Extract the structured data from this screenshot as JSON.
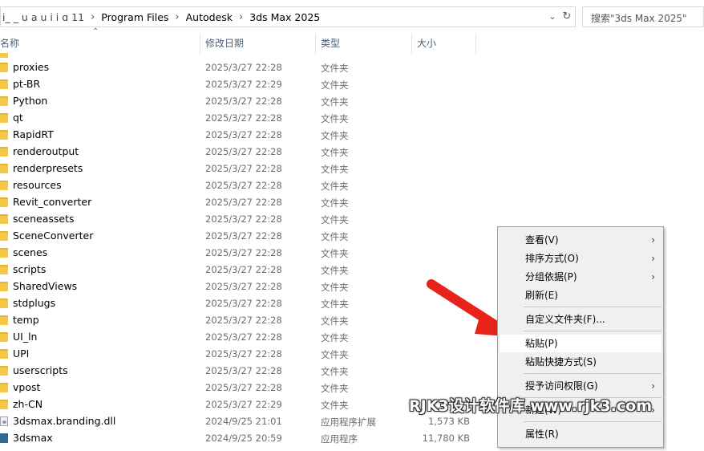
{
  "address_bar": {
    "crumbs": [
      "i_ _ u a u i i ɑ 11",
      "Program Files",
      "Autodesk",
      "3ds Max 2025"
    ],
    "dropdown_icon": "chevron-down-icon",
    "refresh_icon": "refresh-icon"
  },
  "search": {
    "placeholder": "搜索\"3ds Max 2025\""
  },
  "columns": {
    "name": "名称",
    "date": "修改日期",
    "type": "类型",
    "size": "大小"
  },
  "files": [
    {
      "name": "proxies",
      "date": "2025/3/27 22:28",
      "type": "文件夹",
      "size": "",
      "icon": "folder-icon"
    },
    {
      "name": "pt-BR",
      "date": "2025/3/27 22:29",
      "type": "文件夹",
      "size": "",
      "icon": "folder-icon"
    },
    {
      "name": "Python",
      "date": "2025/3/27 22:28",
      "type": "文件夹",
      "size": "",
      "icon": "folder-icon"
    },
    {
      "name": "qt",
      "date": "2025/3/27 22:28",
      "type": "文件夹",
      "size": "",
      "icon": "folder-icon"
    },
    {
      "name": "RapidRT",
      "date": "2025/3/27 22:28",
      "type": "文件夹",
      "size": "",
      "icon": "folder-icon"
    },
    {
      "name": "renderoutput",
      "date": "2025/3/27 22:28",
      "type": "文件夹",
      "size": "",
      "icon": "folder-icon"
    },
    {
      "name": "renderpresets",
      "date": "2025/3/27 22:28",
      "type": "文件夹",
      "size": "",
      "icon": "folder-icon"
    },
    {
      "name": "resources",
      "date": "2025/3/27 22:28",
      "type": "文件夹",
      "size": "",
      "icon": "folder-icon"
    },
    {
      "name": "Revit_converter",
      "date": "2025/3/27 22:28",
      "type": "文件夹",
      "size": "",
      "icon": "folder-icon"
    },
    {
      "name": "sceneassets",
      "date": "2025/3/27 22:28",
      "type": "文件夹",
      "size": "",
      "icon": "folder-icon"
    },
    {
      "name": "SceneConverter",
      "date": "2025/3/27 22:28",
      "type": "文件夹",
      "size": "",
      "icon": "folder-icon"
    },
    {
      "name": "scenes",
      "date": "2025/3/27 22:28",
      "type": "文件夹",
      "size": "",
      "icon": "folder-icon"
    },
    {
      "name": "scripts",
      "date": "2025/3/27 22:28",
      "type": "文件夹",
      "size": "",
      "icon": "folder-icon"
    },
    {
      "name": "SharedViews",
      "date": "2025/3/27 22:28",
      "type": "文件夹",
      "size": "",
      "icon": "folder-icon"
    },
    {
      "name": "stdplugs",
      "date": "2025/3/27 22:28",
      "type": "文件夹",
      "size": "",
      "icon": "folder-icon"
    },
    {
      "name": "temp",
      "date": "2025/3/27 22:28",
      "type": "文件夹",
      "size": "",
      "icon": "folder-icon"
    },
    {
      "name": "UI_ln",
      "date": "2025/3/27 22:28",
      "type": "文件夹",
      "size": "",
      "icon": "folder-icon"
    },
    {
      "name": "UPI",
      "date": "2025/3/27 22:28",
      "type": "文件夹",
      "size": "",
      "icon": "folder-icon"
    },
    {
      "name": "userscripts",
      "date": "2025/3/27 22:28",
      "type": "文件夹",
      "size": "",
      "icon": "folder-icon"
    },
    {
      "name": "vpost",
      "date": "2025/3/27 22:28",
      "type": "文件夹",
      "size": "",
      "icon": "folder-icon"
    },
    {
      "name": "zh-CN",
      "date": "2025/3/27 22:29",
      "type": "文件夹",
      "size": "",
      "icon": "folder-icon"
    },
    {
      "name": "3dsmax.branding.dll",
      "date": "2024/9/25 21:01",
      "type": "应用程序扩展",
      "size": "1,573 KB",
      "icon": "dll-icon"
    },
    {
      "name": "3dsmax",
      "date": "2024/9/25 20:59",
      "type": "应用程序",
      "size": "11,780 KB",
      "icon": "app-icon"
    }
  ],
  "context_menu": {
    "items": [
      {
        "label": "查看(V)",
        "submenu": true
      },
      {
        "label": "排序方式(O)",
        "submenu": true
      },
      {
        "label": "分组依据(P)",
        "submenu": true
      },
      {
        "label": "刷新(E)",
        "submenu": false
      },
      {
        "label": "自定义文件夹(F)...",
        "submenu": false
      },
      {
        "label": "粘贴(P)",
        "submenu": false,
        "highlighted": true
      },
      {
        "label": "粘贴快捷方式(S)",
        "submenu": false
      },
      {
        "label": "授予访问权限(G)",
        "submenu": true
      },
      {
        "label": "新建(W)",
        "submenu": true
      },
      {
        "label": "属性(R)",
        "submenu": false
      }
    ]
  },
  "annotation": {
    "arrow_color": "#e8231b"
  },
  "watermark": {
    "text": "RJK3设计软件库 www.rjk3.com"
  }
}
